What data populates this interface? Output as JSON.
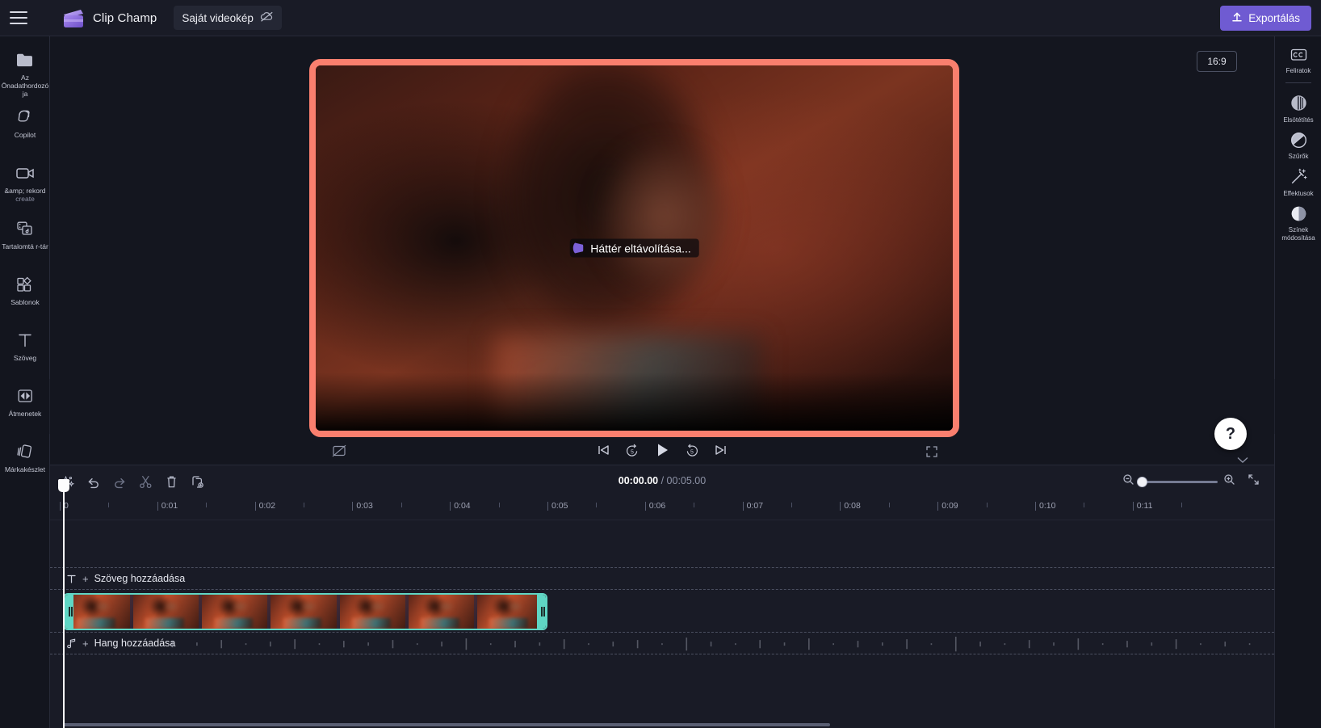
{
  "header": {
    "menu_icon": "hamburger-icon",
    "brand_name": "Clip Champ",
    "brand_logo_icon": "clipchamp-logo-icon",
    "project_name": "Saját videokép",
    "project_cloud_icon": "cloud-off-icon",
    "export_label": "Exportálás",
    "export_icon": "upload-icon",
    "accent_purple": "#6f5bd2"
  },
  "left_rail": {
    "expander_icon": "chevron-right-icon",
    "items": [
      {
        "label": "Az Önadathordozója",
        "sublabel": "",
        "icon": "folder-icon"
      },
      {
        "label": "Copilot",
        "sublabel": "",
        "icon": "copilot-icon"
      },
      {
        "label": "&amp; rekord",
        "sublabel": "create",
        "icon": "video-camera-icon"
      },
      {
        "label": "Tartalomtá r-tár",
        "sublabel": "",
        "icon": "content-library-icon"
      },
      {
        "label": "Sablonok",
        "sublabel": "",
        "icon": "templates-icon"
      },
      {
        "label": "Szöveg",
        "sublabel": "",
        "icon": "text-icon"
      },
      {
        "label": "Átmenetek",
        "sublabel": "",
        "icon": "transitions-icon"
      },
      {
        "label": "Márkakészlet",
        "sublabel": "",
        "icon": "brand-kit-icon"
      }
    ]
  },
  "right_rail": {
    "collapse_icon": "chevron-left-icon",
    "items": [
      {
        "label": "Feliratok",
        "icon": "closed-captions-icon"
      },
      {
        "label": "Elsötétítés",
        "icon": "fade-icon"
      },
      {
        "label": "Szűrők",
        "icon": "filters-icon"
      },
      {
        "label": "Effektusok",
        "icon": "effects-wand-icon"
      },
      {
        "label": "Színek módosítása",
        "icon": "adjust-colors-icon"
      }
    ]
  },
  "preview": {
    "aspect_ratio": "16:9",
    "frame_border_color": "#fa7f6e",
    "toast_text": "Háttér eltávolítása...",
    "toast_spinner_color": "#7b61d8",
    "collapse_icon": "chevron-down-icon",
    "help_label": "?"
  },
  "player_controls": {
    "captions_off_icon": "captions-off-icon",
    "skip_start_icon": "skip-to-start-icon",
    "back5_icon": "rewind-5-icon",
    "back5_label": "5",
    "play_icon": "play-icon",
    "fwd5_icon": "forward-5-icon",
    "fwd5_label": "5",
    "skip_end_icon": "skip-to-end-icon",
    "fullscreen_icon": "fullscreen-icon"
  },
  "timeline": {
    "tools": [
      {
        "name": "magic-sparkle-icon",
        "label": ""
      },
      {
        "name": "undo-icon",
        "label": ""
      },
      {
        "name": "redo-icon",
        "label": ""
      },
      {
        "name": "split-scissors-icon",
        "label": ""
      },
      {
        "name": "delete-trash-icon",
        "label": ""
      },
      {
        "name": "duplicate-icon",
        "label": ""
      }
    ],
    "current_time": "00:00.00",
    "total_time": "/ 00:05.00",
    "zoom_out_icon": "zoom-out-icon",
    "zoom_in_icon": "zoom-in-icon",
    "fit_icon": "fit-timeline-icon",
    "zoom_value": 3,
    "ruler_ticks": [
      "0",
      "0:01",
      "0:02",
      "0:03",
      "0:04",
      "0:05",
      "0:06",
      "0:07",
      "0:08",
      "0:09",
      "0:10",
      "0:11"
    ],
    "text_track": {
      "icon": "text-t-icon",
      "plus": "+",
      "label": "Szöveg hozzáadása"
    },
    "audio_track": {
      "icon": "music-note-icon",
      "plus": "+",
      "label": "Hang hozzáadása"
    },
    "video_clip": {
      "selected": true,
      "select_color": "#5fd6c4",
      "thumb_count": 7,
      "left_handle_icon": "trim-handle-left-icon",
      "right_handle_icon": "trim-handle-right-icon"
    },
    "playhead_position_label": "0"
  }
}
